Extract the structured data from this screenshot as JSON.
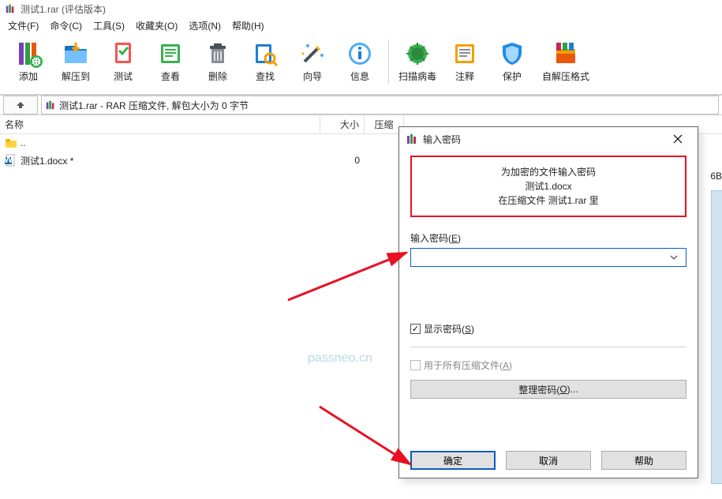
{
  "window": {
    "title": "测试1.rar (评估版本)"
  },
  "menu": {
    "file": "文件(F)",
    "commands": "命令(C)",
    "tools": "工具(S)",
    "favorites": "收藏夹(O)",
    "options": "选项(N)",
    "help": "帮助(H)"
  },
  "toolbar": {
    "add": "添加",
    "extract_to": "解压到",
    "test": "测试",
    "view": "查看",
    "delete": "删除",
    "find": "查找",
    "wizard": "向导",
    "info": "信息",
    "virus_scan": "扫描病毒",
    "comment": "注释",
    "protect": "保护",
    "sfx": "自解压格式"
  },
  "pathbar": {
    "text": "测试1.rar - RAR 压缩文件, 解包大小为 0 字节"
  },
  "columns": {
    "name": "名称",
    "size": "大小",
    "packed": "压缩"
  },
  "rows": {
    "parent": "..",
    "file1_name": "测试1.docx *",
    "file1_size": "0"
  },
  "right_clip": "6B",
  "watermark": "passneo.cn",
  "dialog": {
    "title": "输入密码",
    "info_line1": "为加密的文件输入密码",
    "info_line2": "测试1.docx",
    "info_line3": "在压缩文件 测试1.rar 里",
    "pwd_label_pre": "输入密码(",
    "pwd_label_key": "E",
    "pwd_label_post": ")",
    "show_pwd_pre": "显示密码(",
    "show_pwd_key": "S",
    "show_pwd_post": ")",
    "all_arc_pre": "用于所有压缩文件(",
    "all_arc_key": "A",
    "all_arc_post": ")",
    "organize_pre": "整理密码(",
    "organize_key": "O",
    "organize_post": ")...",
    "ok": "确定",
    "cancel": "取消",
    "help": "帮助"
  }
}
